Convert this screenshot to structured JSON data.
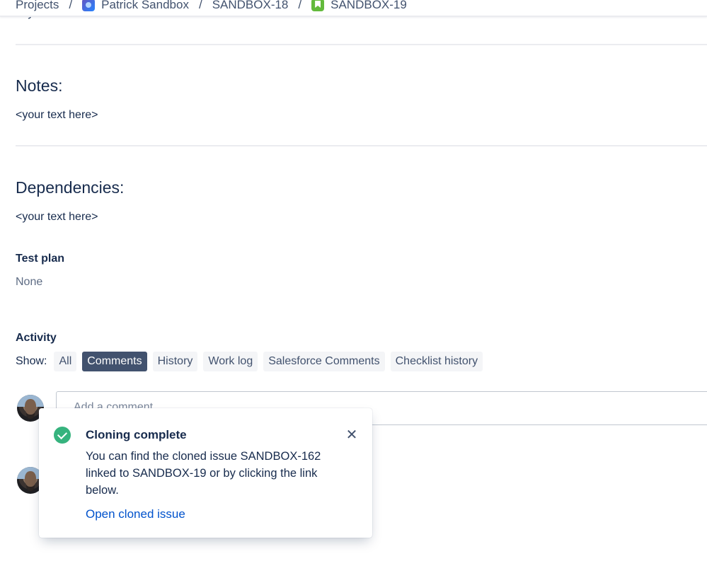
{
  "breadcrumb": {
    "items": [
      "Projects",
      "Patrick Sandbox",
      "SANDBOX-18",
      "SANDBOX-19"
    ],
    "separator": "/"
  },
  "clipped_text": "<your text here>",
  "sections": {
    "notes": {
      "heading": "Notes:",
      "text": "<your text here>"
    },
    "dependencies": {
      "heading": "Dependencies:",
      "text": "<your text here>"
    }
  },
  "fields": {
    "test_plan": {
      "label": "Test plan",
      "value": "None"
    }
  },
  "activity": {
    "title": "Activity",
    "show_label": "Show:",
    "filters": [
      "All",
      "Comments",
      "History",
      "Work log",
      "Salesforce Comments",
      "Checklist history"
    ],
    "active_filter": "Comments",
    "comment_placeholder": "Add a comment..."
  },
  "flag": {
    "title": "Cloning complete",
    "body": "You can find the cloned issue SANDBOX-162 linked to SANDBOX-19 or by clicking the link below.",
    "link": "Open cloned issue",
    "status_color": "#36b37e"
  },
  "colors": {
    "active_filter_bg": "#42526e",
    "link": "#0052cc"
  }
}
